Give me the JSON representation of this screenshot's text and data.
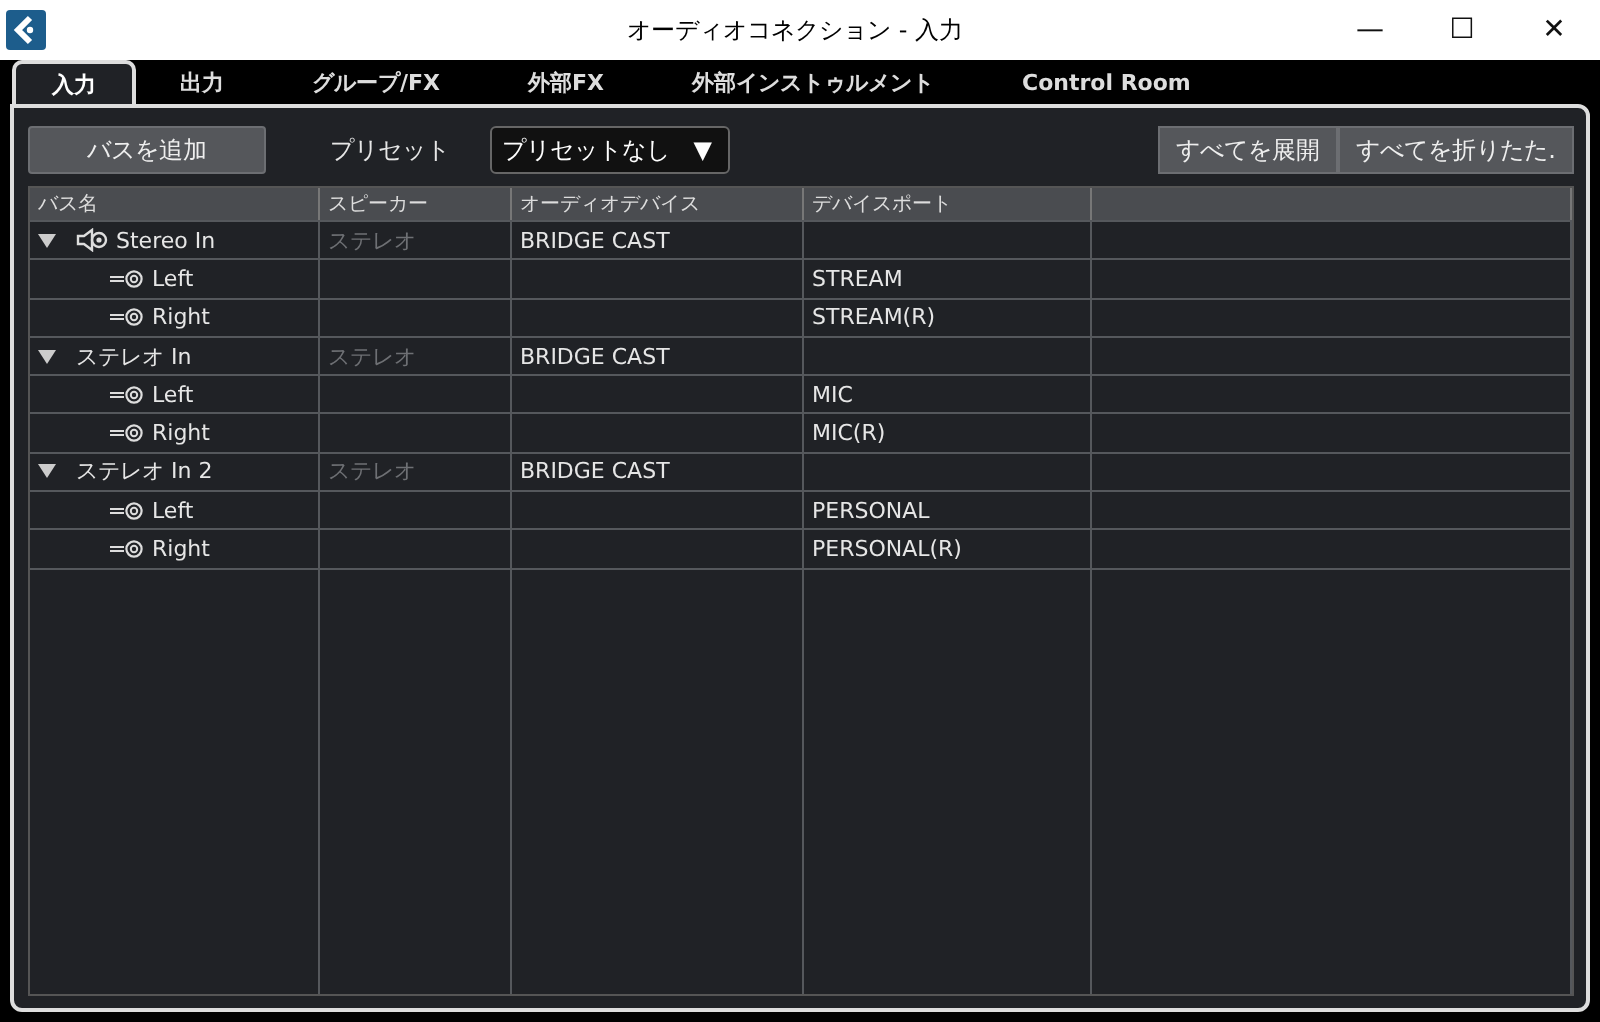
{
  "window": {
    "title": "オーディオコネクション - 入力",
    "controls": [
      "—",
      "☐",
      "✕"
    ]
  },
  "tabs": [
    {
      "label": "入力",
      "selected": true
    },
    {
      "label": "出力",
      "selected": false
    },
    {
      "label": "グループ/FX",
      "selected": false
    },
    {
      "label": "外部FX",
      "selected": false
    },
    {
      "label": "外部インストゥルメント",
      "selected": false
    },
    {
      "label": "Control Room",
      "selected": false
    }
  ],
  "toolbar": {
    "add_button": "バスを追加",
    "preset_label": "プリセット",
    "preset_value": "プリセットなし",
    "preset_caret": "▼",
    "expand_all": "すべてを展開",
    "collapse_all": "すべてを折りたた."
  },
  "table": {
    "columns": [
      "バス名",
      "スピーカー",
      "オーディオデバイス",
      "デバイスポート"
    ],
    "rows": [
      {
        "kind": "main",
        "name": "Stereo In",
        "speaker": "ステレオ",
        "device": "BRIDGE CAST",
        "expanded": true,
        "children": [
          {
            "name": "Left",
            "port": "STREAM"
          },
          {
            "name": "Right",
            "port": "STREAM(R)"
          }
        ]
      },
      {
        "kind": "bus",
        "name": "ステレオ In",
        "speaker": "ステレオ",
        "device": "BRIDGE CAST",
        "expanded": true,
        "children": [
          {
            "name": "Left",
            "port": "MIC"
          },
          {
            "name": "Right",
            "port": "MIC(R)"
          }
        ]
      },
      {
        "kind": "bus",
        "name": "ステレオ In 2",
        "speaker": "ステレオ",
        "device": "BRIDGE CAST",
        "expanded": true,
        "children": [
          {
            "name": "Left",
            "port": "PERSONAL"
          },
          {
            "name": "Right",
            "port": "PERSONAL(R)"
          }
        ]
      }
    ]
  }
}
